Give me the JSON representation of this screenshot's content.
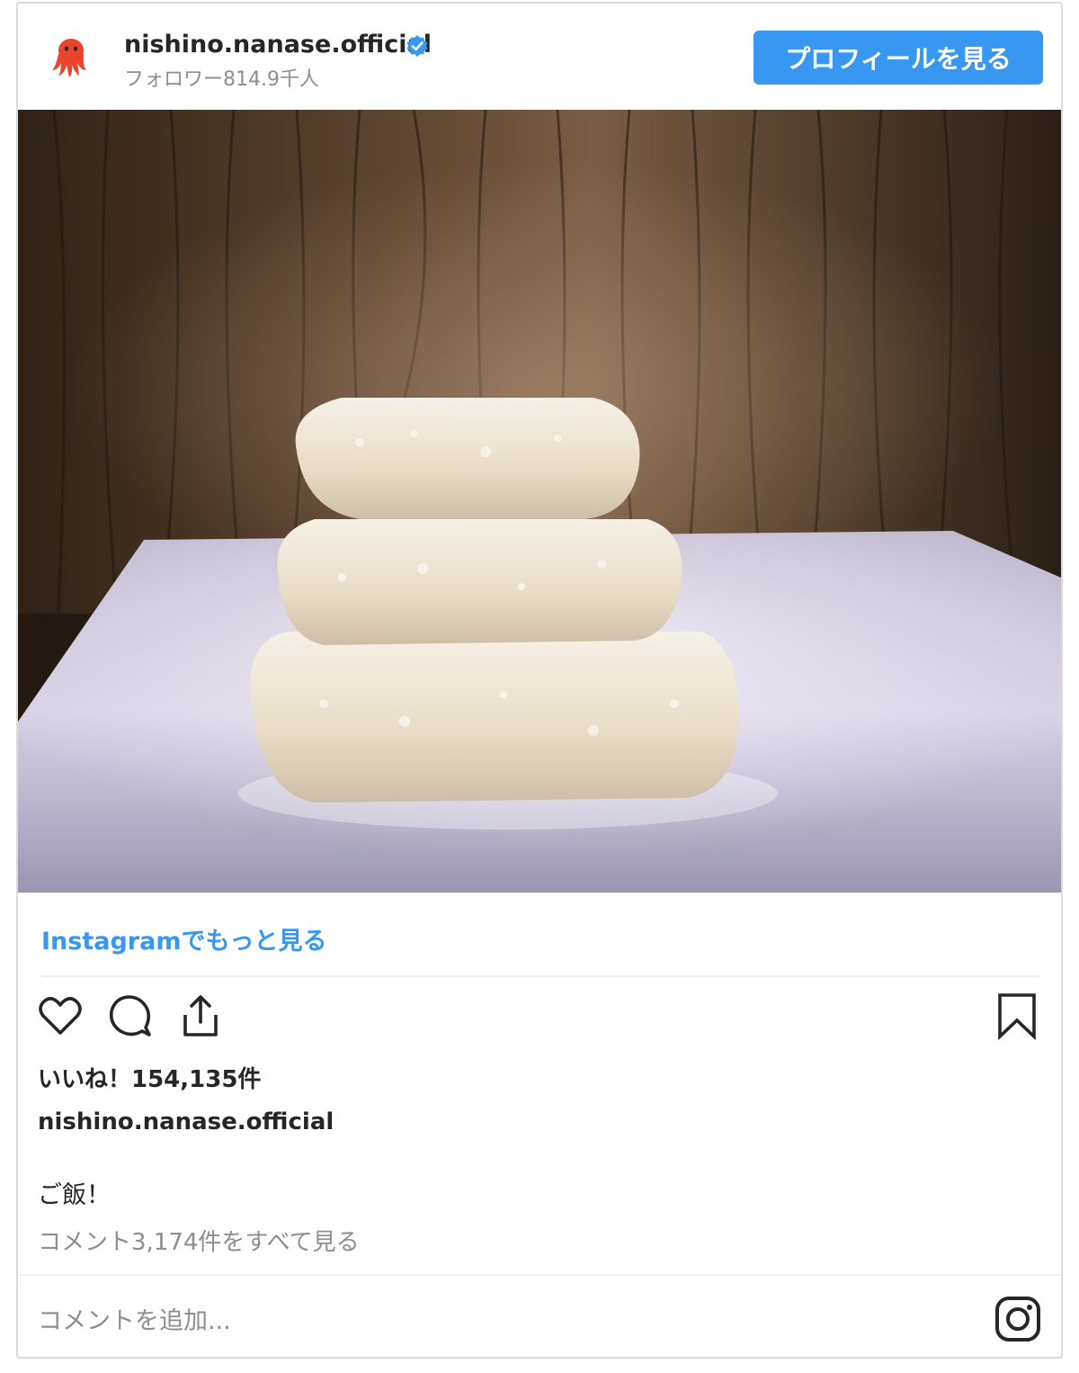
{
  "post": {
    "username": "nishino.nanase.official",
    "followers": "フォロワー814.9千人",
    "profile_button": "プロフィールを見る",
    "more_link": "Instagramでもっと見る",
    "likes": "いいね！154,135件",
    "caption_user": "nishino.nanase.official",
    "caption": "ご飯！",
    "view_comments": "コメント3,174件をすべて見る",
    "comment_placeholder": "コメントを追加..."
  },
  "icons": {
    "avatar": "octopus-avatar",
    "verified": "verified-badge-icon",
    "like": "heart-icon",
    "comment": "comment-bubble-icon",
    "share": "share-icon",
    "save": "bookmark-icon",
    "brand": "instagram-icon"
  },
  "colors": {
    "accent": "#3897f0",
    "avatar": "#e8452c",
    "muted_text": "#8e8e8e",
    "border": "#dbdbdb"
  }
}
